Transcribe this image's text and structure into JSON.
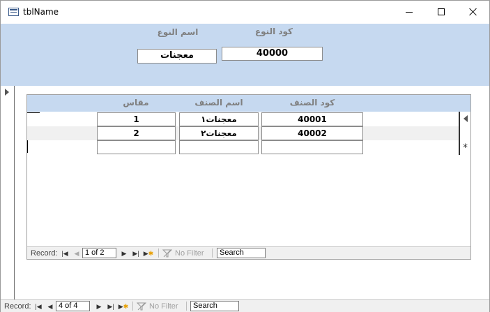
{
  "window": {
    "title": "tblName"
  },
  "main_form": {
    "labels": {
      "type_code": "كود النوع",
      "type_name": "اسم النوع"
    },
    "fields": {
      "type_code": "40000",
      "type_name": "معجنات"
    }
  },
  "subform": {
    "columns": [
      "كود الصنف",
      "اسم الصنف",
      "مقاس"
    ],
    "rows": [
      {
        "code": "40001",
        "name": "معجنات١",
        "size": "1"
      },
      {
        "code": "40002",
        "name": "معجنات٢",
        "size": "2"
      }
    ],
    "new_row_marker": "*",
    "nav": {
      "record_label": "Record:",
      "position": "1 of 2",
      "filter_label": "No Filter",
      "search_value": "Search"
    }
  },
  "form_nav": {
    "record_label": "Record:",
    "position": "4 of 4",
    "filter_label": "No Filter",
    "search_value": "Search"
  },
  "icons": {
    "app": "table-form-icon",
    "minimize": "minimize-icon",
    "maximize": "maximize-icon",
    "close": "close-icon",
    "first": "first-record-icon",
    "prev": "previous-record-icon",
    "next": "next-record-icon",
    "last": "last-record-icon",
    "new": "new-record-icon",
    "filter": "funnel-icon"
  },
  "colors": {
    "header_band": "#c6d9f0",
    "label_text": "#7f7f7f",
    "alt_row": "#f0f0f0"
  }
}
